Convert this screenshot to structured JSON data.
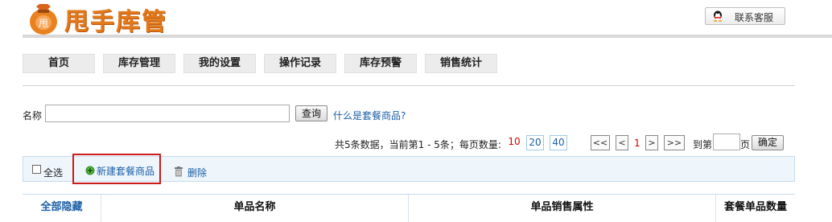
{
  "header": {
    "brand": "甩手库管",
    "logo_char": "甩",
    "contact_label": "联系客服"
  },
  "nav": {
    "items": [
      {
        "label": "首页"
      },
      {
        "label": "库存管理"
      },
      {
        "label": "我的设置"
      },
      {
        "label": "操作记录"
      },
      {
        "label": "库存预警"
      },
      {
        "label": "销售统计"
      }
    ]
  },
  "search": {
    "label": "名称",
    "value": "",
    "button": "查询",
    "help_link": "什么是套餐商品?"
  },
  "pager": {
    "summary_prefix": "共5条数据，当前第1 - 5条；每页数量:",
    "page_sizes": [
      "10",
      "20",
      "40"
    ],
    "first": "<<",
    "prev": "<",
    "current": "1",
    "next": ">",
    "last": ">>",
    "goto_prefix": "到第",
    "goto_suffix": "页",
    "confirm": "确定"
  },
  "toolbar": {
    "select_all": "全选",
    "new_bundle": "新建套餐商品",
    "delete": "删除"
  },
  "table": {
    "columns": [
      "全部隐藏",
      "单品名称",
      "单品销售属性",
      "套餐单品数量"
    ]
  },
  "colors": {
    "brand": "#e2791b",
    "link": "#1a5fa6",
    "highlight_border": "#cc1a1a",
    "current_page": "#d40000"
  },
  "icons": {
    "logo": "money-bag-icon",
    "contact": "qq-penguin-icon",
    "new": "add-green-icon",
    "delete": "trash-icon"
  }
}
